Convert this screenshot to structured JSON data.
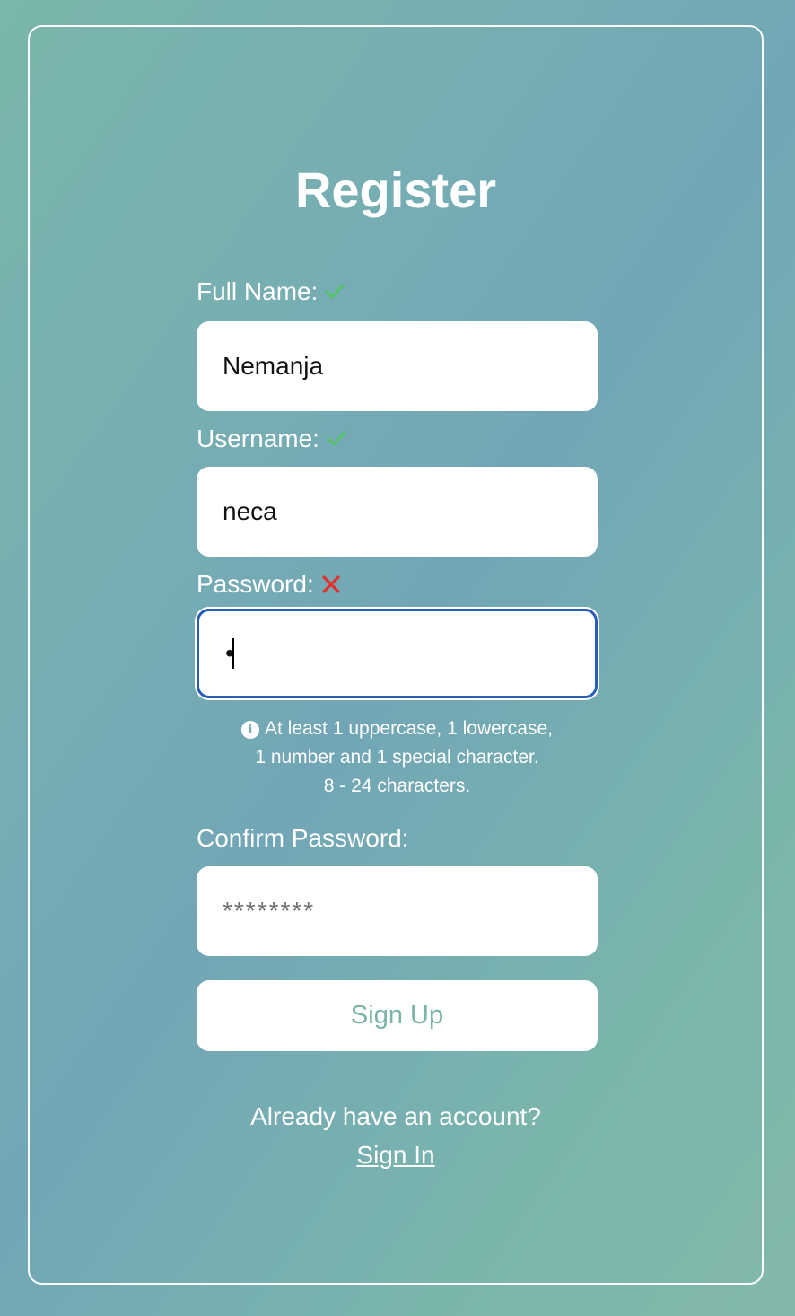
{
  "title": "Register",
  "fields": {
    "full_name": {
      "label": "Full Name:",
      "value": "Nemanja",
      "status": "valid",
      "status_icon": "check-icon"
    },
    "username": {
      "label": "Username:",
      "value": "neca",
      "status": "valid",
      "status_icon": "check-icon"
    },
    "password": {
      "label": "Password:",
      "value": "•",
      "status": "invalid",
      "status_icon": "cross-icon"
    },
    "confirm_password": {
      "label": "Confirm Password:",
      "value": "",
      "placeholder": "********"
    }
  },
  "password_hint": {
    "line1": "At least 1 uppercase, 1 lowercase,",
    "line2": "1 number and 1 special character.",
    "line3": "8 - 24 characters."
  },
  "submit_label": "Sign Up",
  "footer": {
    "prompt": "Already have an account?",
    "link_label": "Sign In"
  },
  "colors": {
    "valid": "#55c26a",
    "invalid": "#e2302b",
    "focus_border": "#2a5db8",
    "button_text": "#7ab3a7"
  }
}
